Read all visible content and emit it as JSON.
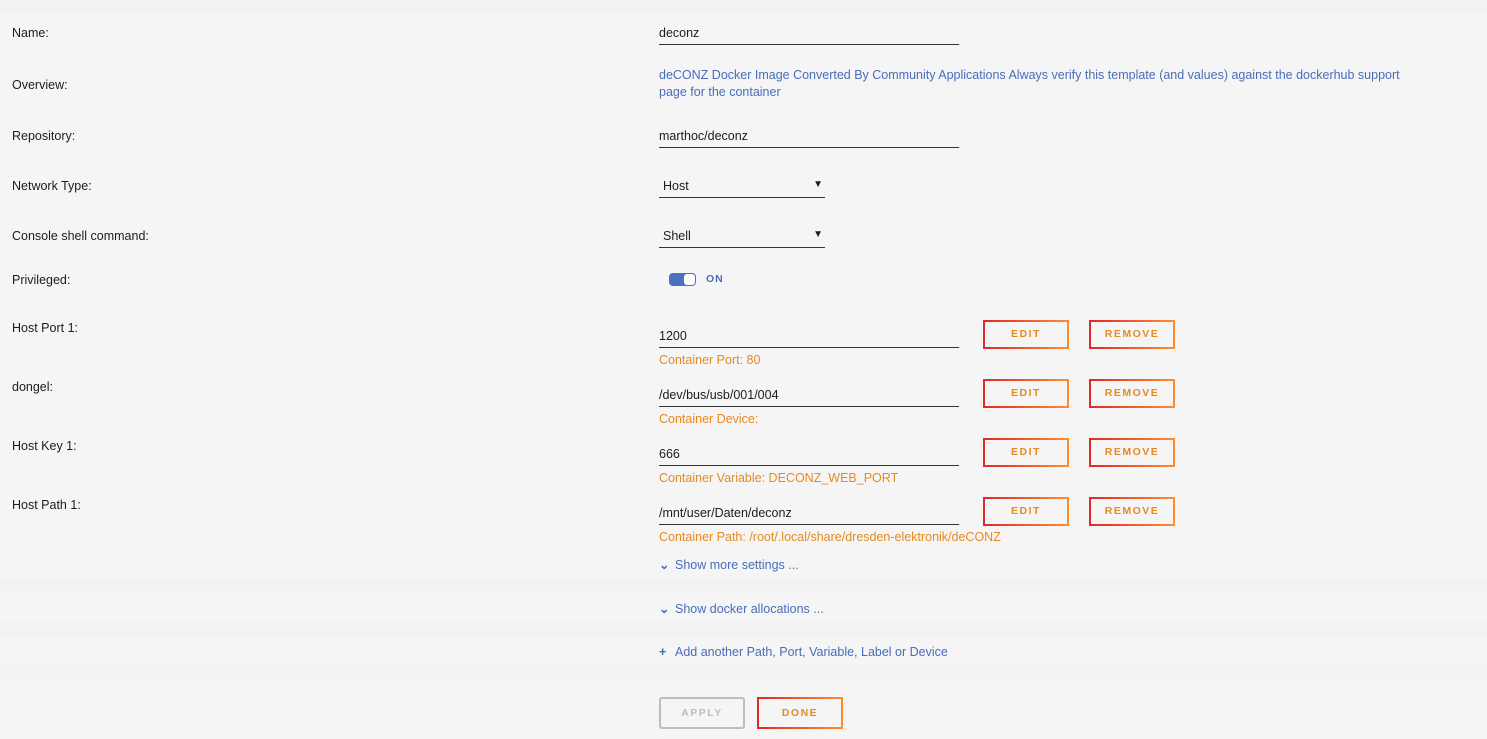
{
  "fields": {
    "name": {
      "label": "Name:",
      "value": "deconz"
    },
    "overview": {
      "label": "Overview:",
      "value": "deCONZ Docker Image Converted By Community Applications Always verify this template (and values) against the dockerhub support page for the container"
    },
    "repository": {
      "label": "Repository:",
      "value": "marthoc/deconz"
    },
    "network_type": {
      "label": "Network Type:",
      "value": "Host"
    },
    "console_shell": {
      "label": "Console shell command:",
      "value": "Shell"
    },
    "privileged": {
      "label": "Privileged:",
      "state": "ON"
    }
  },
  "mappings": [
    {
      "label": "Host Port 1:",
      "value": "1200",
      "hint": "Container Port: 80"
    },
    {
      "label": "dongel:",
      "value": "/dev/bus/usb/001/004",
      "hint": "Container Device:"
    },
    {
      "label": "Host Key 1:",
      "value": "666",
      "hint": "Container Variable: DECONZ_WEB_PORT"
    },
    {
      "label": "Host Path 1:",
      "value": "/mnt/user/Daten/deconz",
      "hint": "Container Path: /root/.local/share/dresden-elektronik/deCONZ"
    }
  ],
  "buttons": {
    "edit": "EDIT",
    "remove": "REMOVE",
    "apply": "APPLY",
    "done": "DONE"
  },
  "links": {
    "show_more": "Show more settings ...",
    "show_docker": "Show docker allocations ...",
    "add_another": "Add another Path, Port, Variable, Label or Device"
  },
  "colors": {
    "accent_blue": "#486dba",
    "accent_orange": "#e68a1f",
    "button_red": "#e4412c"
  }
}
